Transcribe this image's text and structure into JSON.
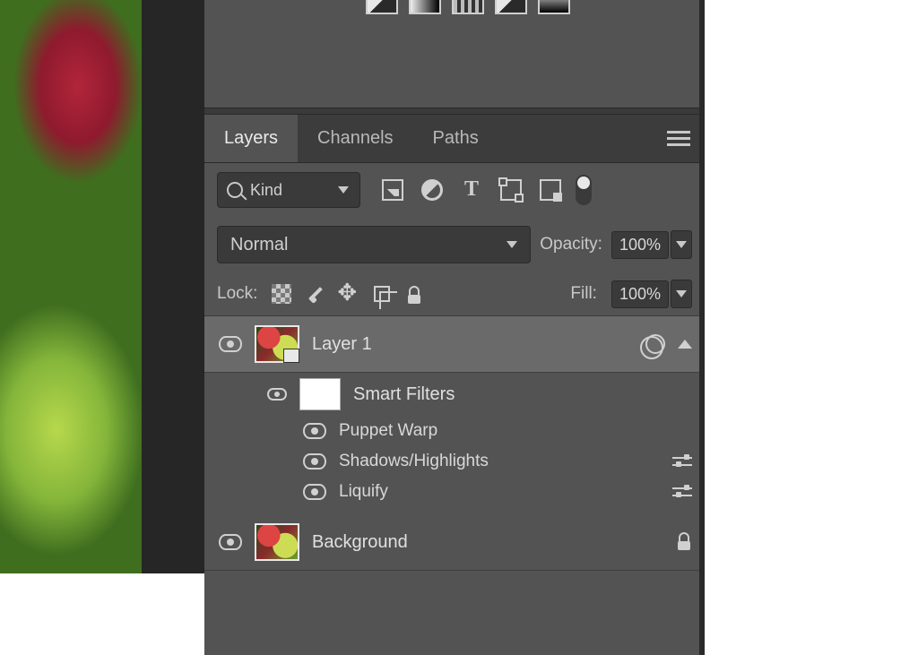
{
  "tabs": {
    "layers": "Layers",
    "channels": "Channels",
    "paths": "Paths"
  },
  "filter": {
    "kind": "Kind"
  },
  "blend": {
    "mode": "Normal",
    "opacity_label": "Opacity:",
    "opacity_value": "100%"
  },
  "lock": {
    "label": "Lock:",
    "fill_label": "Fill:",
    "fill_value": "100%"
  },
  "layers": {
    "layer1": {
      "name": "Layer 1"
    },
    "smart_filters": {
      "label": "Smart Filters"
    },
    "filters": {
      "puppet_warp": "Puppet Warp",
      "shadows_highlights": "Shadows/Highlights",
      "liquify": "Liquify"
    },
    "background": {
      "name": "Background"
    }
  }
}
